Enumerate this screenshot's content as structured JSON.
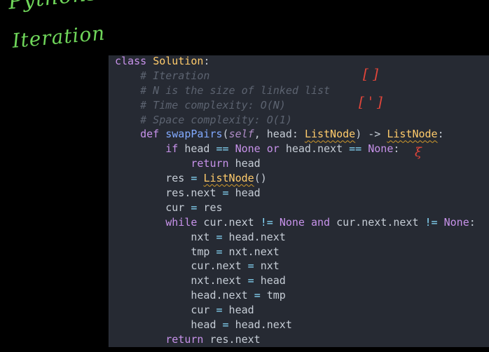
{
  "handwriting": {
    "top": "Pythons",
    "iteration": "Iteration"
  },
  "annotations": [
    "[ ]",
    "[ ' ]",
    "ξ"
  ],
  "code": {
    "l1": {
      "kw": "class",
      "cls": "Solution",
      "rest": ":"
    },
    "l2": "# Iteration",
    "l3": "# N is the size of linked list",
    "l4": "# Time complexity: O(N)",
    "l5": "# Space complexity: O(1)",
    "l6": {
      "def": "def",
      "fn": "swapPairs",
      "open": "(",
      "self": "self",
      "p1": ", head: ",
      "type1": "ListNode",
      "p2": ") -> ",
      "type2": "ListNode",
      "end": ":"
    },
    "l7": {
      "if": "if",
      "a": " head ",
      "eq1": "==",
      "none1": "None",
      "or": "or",
      "b": " head.next ",
      "eq2": "==",
      "none2": "None",
      "end": ":"
    },
    "l8": {
      "ret": "return",
      "rest": " head"
    },
    "l9": {
      "a": "res ",
      "eq": "=",
      "cls": "ListNode",
      "rest": "()"
    },
    "l10": {
      "a": "res.next ",
      "eq": "=",
      "rest": " head"
    },
    "l11": {
      "a": "cur ",
      "eq": "=",
      "rest": " res"
    },
    "l12": {
      "while": "while",
      "a": " cur.next ",
      "ne1": "!=",
      "none1": "None",
      "and": "and",
      "b": " cur.next.next ",
      "ne2": "!=",
      "none2": "None",
      "end": ":"
    },
    "l13": {
      "a": "nxt ",
      "eq": "=",
      "rest": " head.next"
    },
    "l14": {
      "a": "tmp ",
      "eq": "=",
      "rest": " nxt.next"
    },
    "l15": {
      "a": "cur.next ",
      "eq": "=",
      "rest": " nxt"
    },
    "l16": {
      "a": "nxt.next ",
      "eq": "=",
      "rest": " head"
    },
    "l17": {
      "a": "head.next ",
      "eq": "=",
      "rest": " tmp"
    },
    "l18": {
      "a": "cur ",
      "eq": "=",
      "rest": " head"
    },
    "l19": {
      "a": "head ",
      "eq": "=",
      "rest": " head.next"
    },
    "l20": {
      "ret": "return",
      "rest": " res.next"
    }
  }
}
